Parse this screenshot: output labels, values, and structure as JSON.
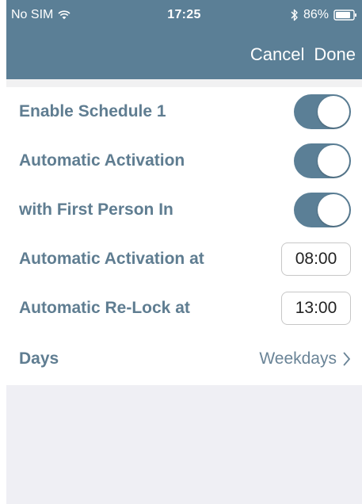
{
  "status_bar": {
    "carrier": "No SIM",
    "time": "17:25",
    "battery": "86%",
    "icons": {
      "wifi": "wifi-icon",
      "bluetooth": "bluetooth-icon",
      "battery": "battery-icon"
    }
  },
  "nav": {
    "cancel_label": "Cancel",
    "done_label": "Done"
  },
  "rows": [
    {
      "label": "Enable Schedule 1",
      "control": "toggle",
      "on": true
    },
    {
      "label": "Automatic Activation",
      "control": "toggle",
      "on": true
    },
    {
      "label": "with First Person In",
      "control": "toggle",
      "on": true
    },
    {
      "label": "Automatic Activation at",
      "control": "time",
      "value": "08:00"
    },
    {
      "label": "Automatic Re-Lock at",
      "control": "time",
      "value": "13:00"
    },
    {
      "label": "Days",
      "control": "disclosure",
      "value": "Weekdays"
    }
  ],
  "colors": {
    "header": "#5b7f96",
    "label": "#5f7d91",
    "toggle_on": "#5b7f96",
    "background": "#efeff4"
  }
}
